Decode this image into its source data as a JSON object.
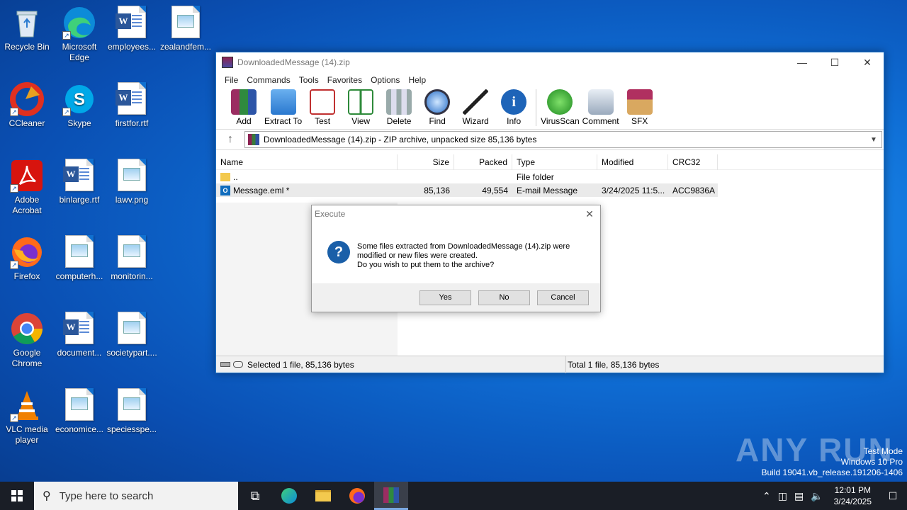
{
  "desktop": {
    "icons": [
      {
        "label": "Recycle Bin"
      },
      {
        "label": "Microsoft Edge"
      },
      {
        "label": "employees..."
      },
      {
        "label": "zealandfem..."
      },
      {
        "label": "CCleaner"
      },
      {
        "label": "Skype"
      },
      {
        "label": "firstfor.rtf"
      },
      {
        "label": "Adobe Acrobat"
      },
      {
        "label": "binlarge.rtf"
      },
      {
        "label": "lawv.png"
      },
      {
        "label": "Firefox"
      },
      {
        "label": "computerh..."
      },
      {
        "label": "monitorin..."
      },
      {
        "label": "Google Chrome"
      },
      {
        "label": "document..."
      },
      {
        "label": "societypart...."
      },
      {
        "label": "VLC media player"
      },
      {
        "label": "economice..."
      },
      {
        "label": "speciesspe..."
      }
    ]
  },
  "window": {
    "title": "DownloadedMessage (14).zip",
    "menu": [
      "File",
      "Commands",
      "Tools",
      "Favorites",
      "Options",
      "Help"
    ],
    "toolbar": [
      {
        "label": "Add",
        "icon": "add-icon"
      },
      {
        "label": "Extract To",
        "icon": "extract-icon"
      },
      {
        "label": "Test",
        "icon": "test-icon"
      },
      {
        "label": "View",
        "icon": "view-icon"
      },
      {
        "label": "Delete",
        "icon": "delete-icon"
      },
      {
        "label": "Find",
        "icon": "find-icon"
      },
      {
        "label": "Wizard",
        "icon": "wizard-icon"
      },
      {
        "label": "Info",
        "icon": "info-icon"
      },
      {
        "label": "VirusScan",
        "icon": "virusscan-icon"
      },
      {
        "label": "Comment",
        "icon": "comment-icon"
      },
      {
        "label": "SFX",
        "icon": "sfx-icon"
      }
    ],
    "address": "DownloadedMessage (14).zip - ZIP archive, unpacked size 85,136 bytes",
    "columns": [
      "Name",
      "Size",
      "Packed",
      "Type",
      "Modified",
      "CRC32"
    ],
    "rows": [
      {
        "name": "..",
        "size": "",
        "packed": "",
        "type": "File folder",
        "modified": "",
        "crc": ""
      },
      {
        "name": "Message.eml *",
        "size": "85,136",
        "packed": "49,554",
        "type": "E-mail Message",
        "modified": "3/24/2025 11:5...",
        "crc": "ACC9836A"
      }
    ],
    "status_left": "Selected 1 file, 85,136 bytes",
    "status_right": "Total 1 file, 85,136 bytes"
  },
  "dialog": {
    "title": "Execute",
    "message_line1": "Some files extracted from DownloadedMessage (14).zip were",
    "message_line2": "modified or new files were created.",
    "message_line3": "Do you wish to put them to the archive?",
    "yes": "Yes",
    "no": "No",
    "cancel": "Cancel"
  },
  "taskbar": {
    "search_placeholder": "Type here to search",
    "time": "12:01 PM",
    "date": "3/24/2025"
  },
  "watermark": {
    "brand": "ANY RUN",
    "line1": "Test Mode",
    "line2": "Windows 10 Pro",
    "line3": "Build 19041.vb_release.191206-1406"
  },
  "colors": {
    "accent": "#1e73c8",
    "taskbar": "#1a1e26"
  }
}
